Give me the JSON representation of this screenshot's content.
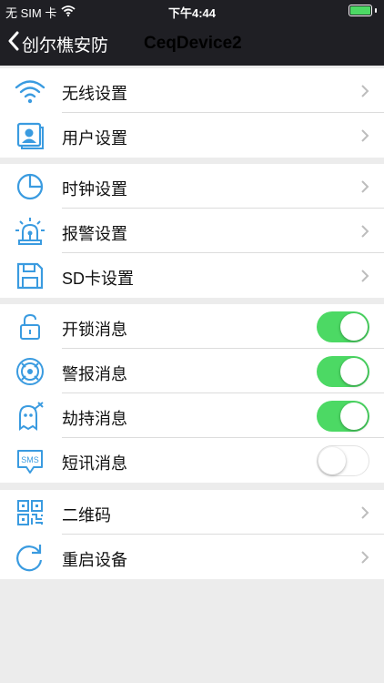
{
  "status_bar": {
    "carrier": "无 SIM 卡",
    "time": "下午4:44"
  },
  "nav": {
    "back_label": "创尔樵安防",
    "title": "CeqDevice2"
  },
  "groups": [
    {
      "rows": [
        {
          "label": "无线设置",
          "icon": "wifi-icon",
          "control": "chevron"
        },
        {
          "label": "用户设置",
          "icon": "user-card-icon",
          "control": "chevron"
        }
      ]
    },
    {
      "rows": [
        {
          "label": "时钟设置",
          "icon": "clock-pie-icon",
          "control": "chevron"
        },
        {
          "label": "报警设置",
          "icon": "alarm-light-icon",
          "control": "chevron"
        },
        {
          "label": "SD卡设置",
          "icon": "sd-card-icon",
          "control": "chevron"
        }
      ]
    },
    {
      "rows": [
        {
          "label": "开锁消息",
          "icon": "unlock-icon",
          "control": "toggle",
          "on": true
        },
        {
          "label": "警报消息",
          "icon": "siren-icon",
          "control": "toggle",
          "on": true
        },
        {
          "label": "劫持消息",
          "icon": "ghost-icon",
          "control": "toggle",
          "on": true
        },
        {
          "label": "短讯消息",
          "icon": "sms-icon",
          "control": "toggle",
          "on": false
        }
      ]
    },
    {
      "rows": [
        {
          "label": "二维码",
          "icon": "qr-code-icon",
          "control": "chevron"
        },
        {
          "label": "重启设备",
          "icon": "restart-icon",
          "control": "chevron"
        }
      ]
    }
  ],
  "colors": {
    "accent": "#3a9be0",
    "toggle_on": "#4cd964",
    "header_bg": "#1f1f24"
  }
}
